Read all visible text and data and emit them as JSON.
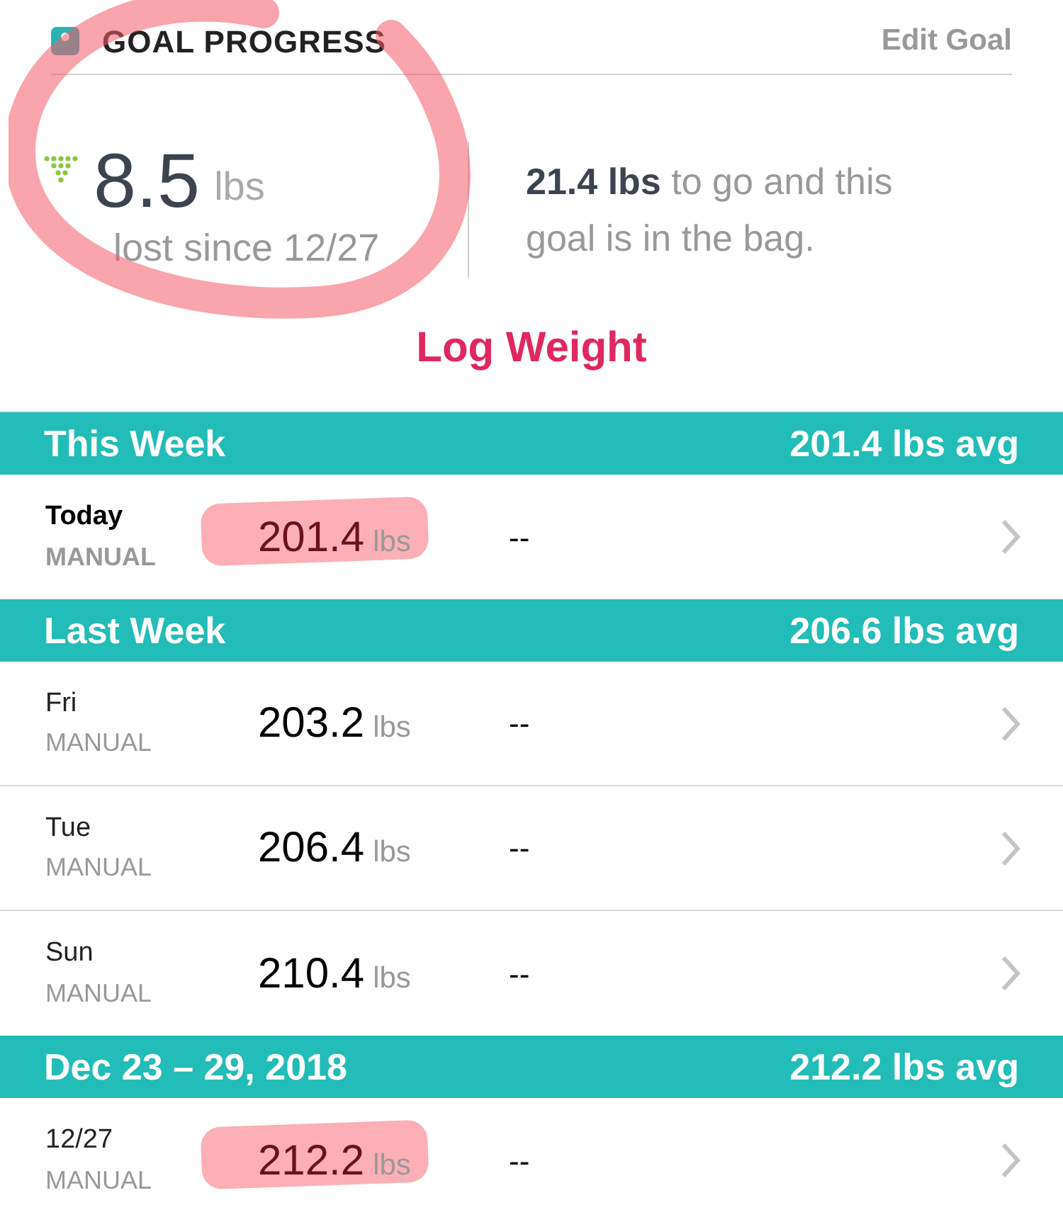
{
  "goal": {
    "title": "GOAL PROGRESS",
    "edit_link": "Edit Goal",
    "lost_value": "8.5",
    "lost_unit": "lbs",
    "lost_caption": "lost since 12/27",
    "circled": true,
    "remaining": "**21.4 lbs** to go and this goal is in the bag."
  },
  "log_button": "Log Weight",
  "sections": [
    {
      "title": "This Week",
      "average": "201.4 lbs avg",
      "entries": [
        {
          "day": "Today",
          "emphasized": true,
          "source": "MANUAL",
          "value": "201.4",
          "unit": "lbs",
          "fat": "--",
          "highlighted": true
        }
      ]
    },
    {
      "title": "Last Week",
      "average": "206.6 lbs avg",
      "entries": [
        {
          "day": "Fri",
          "emphasized": false,
          "source": "MANUAL",
          "value": "203.2",
          "unit": "lbs",
          "fat": "--",
          "highlighted": false
        },
        {
          "day": "Tue",
          "emphasized": false,
          "source": "MANUAL",
          "value": "206.4",
          "unit": "lbs",
          "fat": "--",
          "highlighted": false
        },
        {
          "day": "Sun",
          "emphasized": false,
          "source": "MANUAL",
          "value": "210.4",
          "unit": "lbs",
          "fat": "--",
          "highlighted": false
        }
      ]
    },
    {
      "title": "Dec 23 – 29, 2018",
      "average": "212.2 lbs avg",
      "entries": [
        {
          "day": "12/27",
          "emphasized": false,
          "source": "MANUAL",
          "value": "212.2",
          "unit": "lbs",
          "fat": "--",
          "highlighted": true
        }
      ]
    }
  ]
}
